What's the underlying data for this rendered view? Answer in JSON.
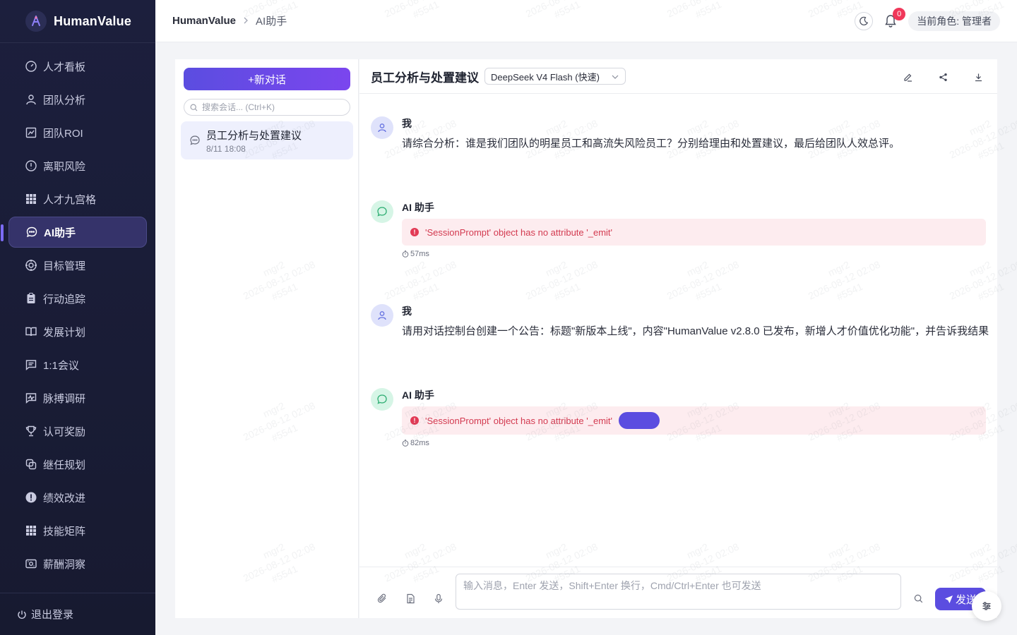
{
  "app": {
    "name": "HumanValue"
  },
  "sidebar": {
    "items": [
      {
        "label": "人才看板",
        "icon": "dashboard-icon"
      },
      {
        "label": "团队分析",
        "icon": "user-icon"
      },
      {
        "label": "团队ROI",
        "icon": "chart-icon"
      },
      {
        "label": "离职风险",
        "icon": "alert-circle-icon"
      },
      {
        "label": "人才九宫格",
        "icon": "grid-icon"
      },
      {
        "label": "AI助手",
        "icon": "chat-icon",
        "active": true
      },
      {
        "label": "目标管理",
        "icon": "target-icon"
      },
      {
        "label": "行动追踪",
        "icon": "clipboard-icon"
      },
      {
        "label": "发展计划",
        "icon": "book-icon"
      },
      {
        "label": "1:1会议",
        "icon": "message-square-icon"
      },
      {
        "label": "脉搏调研",
        "icon": "pulse-icon"
      },
      {
        "label": "认可奖励",
        "icon": "trophy-icon"
      },
      {
        "label": "继任规划",
        "icon": "copy-icon"
      },
      {
        "label": "绩效改进",
        "icon": "exclamation-icon"
      },
      {
        "label": "技能矩阵",
        "icon": "grid-icon"
      },
      {
        "label": "薪酬洞察",
        "icon": "money-icon"
      }
    ],
    "logout_label": "退出登录"
  },
  "topbar": {
    "breadcrumb_root": "HumanValue",
    "breadcrumb_current": "AI助手",
    "notification_count": "0",
    "role_label": "当前角色: 管理者"
  },
  "conversations": {
    "new_button_label": "+新对话",
    "search_placeholder": "搜索会话... (Ctrl+K)",
    "items": [
      {
        "title": "员工分析与处置建议",
        "time": "8/11 18:08"
      }
    ]
  },
  "chat": {
    "title": "员工分析与处置建议",
    "model": "DeepSeek V4 Flash (快速)",
    "messages": [
      {
        "role": "user",
        "name": "我",
        "text": "请综合分析：谁是我们团队的明星员工和高流失风险员工？分别给理由和处置建议，最后给团队人效总评。"
      },
      {
        "role": "ai",
        "name": "AI 助手",
        "error": "'SessionPrompt' object has no attribute '_emit'",
        "latency": "57ms"
      },
      {
        "role": "user",
        "name": "我",
        "text": "请用对话控制台创建一个公告：标题\"新版本上线\"，内容\"HumanValue v2.8.0 已发布，新增人才价值优化功能\"，并告诉我结果"
      },
      {
        "role": "ai",
        "name": "AI 助手",
        "error": "'SessionPrompt' object has no attribute '_emit'",
        "latency": "82ms"
      }
    ],
    "input_placeholder": "输入消息，Enter 发送，Shift+Enter 换行，Cmd/Ctrl+Enter 也可发送",
    "send_label": "发送"
  },
  "watermark": {
    "line1": "mgr2",
    "line2": "2026-08-12 02:08",
    "line3": "#5541"
  },
  "colors": {
    "accent": "#5b4de0",
    "sidebar_bg": "#1c1f3d",
    "error": "#d33a50",
    "error_bg": "#fdecef"
  }
}
